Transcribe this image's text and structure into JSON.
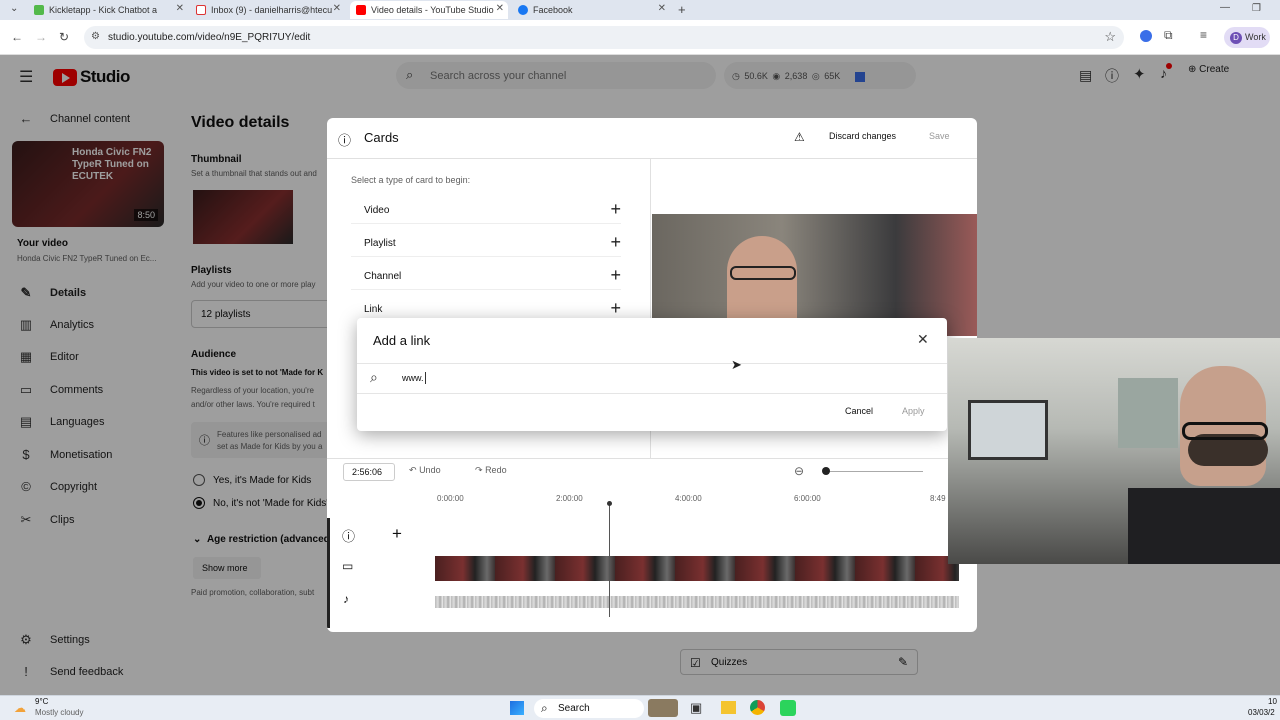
{
  "browser": {
    "tabs": [
      {
        "title": "Kickletapp - Kick Chatbot a"
      },
      {
        "title": "Inbox (9) - danielharris@htecu"
      },
      {
        "title": "Video details - YouTube Studio"
      },
      {
        "title": "Facebook"
      }
    ],
    "url": "studio.youtube.com/video/n9E_PQRI7UY/edit",
    "profile_initial": "D",
    "profile_label": "Work"
  },
  "yt_header": {
    "logo_text": "Studio",
    "search_placeholder": "Search across your channel",
    "stats": {
      "views": "50.6K",
      "watch": "2,638",
      "subs": "65K"
    },
    "create_label": "Create"
  },
  "sidebar": {
    "back_label": "Channel content",
    "video_thumb_text": "Honda Civic FN2 TypeR Tuned on ECUTEK",
    "video_duration": "8:50",
    "your_video_label": "Your video",
    "video_title": "Honda Civic FN2 TypeR Tuned on Ec...",
    "items": [
      {
        "label": "Details",
        "icon": "pencil-icon"
      },
      {
        "label": "Analytics",
        "icon": "analytics-icon"
      },
      {
        "label": "Editor",
        "icon": "editor-icon"
      },
      {
        "label": "Comments",
        "icon": "comments-icon"
      },
      {
        "label": "Languages",
        "icon": "languages-icon"
      },
      {
        "label": "Monetisation",
        "icon": "dollar-icon"
      },
      {
        "label": "Copyright",
        "icon": "copyright-icon"
      },
      {
        "label": "Clips",
        "icon": "scissors-icon"
      }
    ],
    "settings_label": "Settings",
    "feedback_label": "Send feedback"
  },
  "main": {
    "page_title": "Video details",
    "thumbnail_heading": "Thumbnail",
    "thumbnail_desc": "Set a thumbnail that stands out and",
    "playlists_heading": "Playlists",
    "playlists_desc": "Add your video to one or more play",
    "playlists_value": "12 playlists",
    "audience_heading": "Audience",
    "audience_bold": "This video is set to not 'Made for K",
    "audience_desc1": "Regardless of your location, you're",
    "audience_desc2": "and/or other laws. You're required t",
    "info_box1": "Features like personalised ad",
    "info_box2": "set as Made for Kids by you a",
    "radio_yes": "Yes, it's Made for Kids",
    "radio_no": "No, it's not 'Made for Kids'",
    "age_restriction": "Age restriction (advanced",
    "show_more": "Show more",
    "paid_promo": "Paid promotion, collaboration, subt",
    "quizzes_label": "Quizzes"
  },
  "cards_panel": {
    "title": "Cards",
    "discard_label": "Discard changes",
    "save_label": "Save",
    "prompt": "Select a type of card to begin:",
    "types": [
      "Video",
      "Playlist",
      "Channel",
      "Link"
    ],
    "time_value": "2:56:06",
    "undo_label": "Undo",
    "redo_label": "Redo",
    "timeline_ticks": [
      "0:00:00",
      "2:00:00",
      "4:00:00",
      "6:00:00",
      "8:49"
    ]
  },
  "link_dialog": {
    "title": "Add a link",
    "input_value": "www.",
    "cancel_label": "Cancel",
    "apply_label": "Apply"
  },
  "taskbar": {
    "temperature": "9°C",
    "weather": "Mostly cloudy",
    "search_label": "Search",
    "clock_time": "10",
    "clock_date": "03/03/2"
  }
}
